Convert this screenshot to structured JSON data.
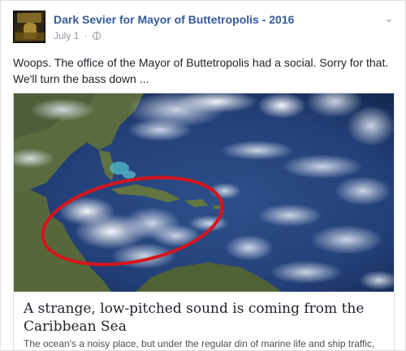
{
  "post": {
    "page_name": "Dark Sevier for Mayor of Buttetropolis - 2016",
    "date": "July 1",
    "separator": "·",
    "privacy_icon": "globe-icon",
    "menu_icon": "chevron-down-icon",
    "text_line1": "Woops. The office of the Mayor of Buttetropolis had a social. Sorry for that.",
    "text_line2": "We'll turn the bass down ..."
  },
  "link": {
    "image_description_icon": "satellite-image",
    "title": "A strange, low-pitched sound is coming from the Caribbean Sea",
    "description": "The ocean's a noisy place, but under the regular din of marine life and ship traffic,"
  },
  "colors": {
    "link_blue": "#365899",
    "meta_gray": "#90949c",
    "text": "#1d2129",
    "annotation_red": "#d7141a"
  }
}
